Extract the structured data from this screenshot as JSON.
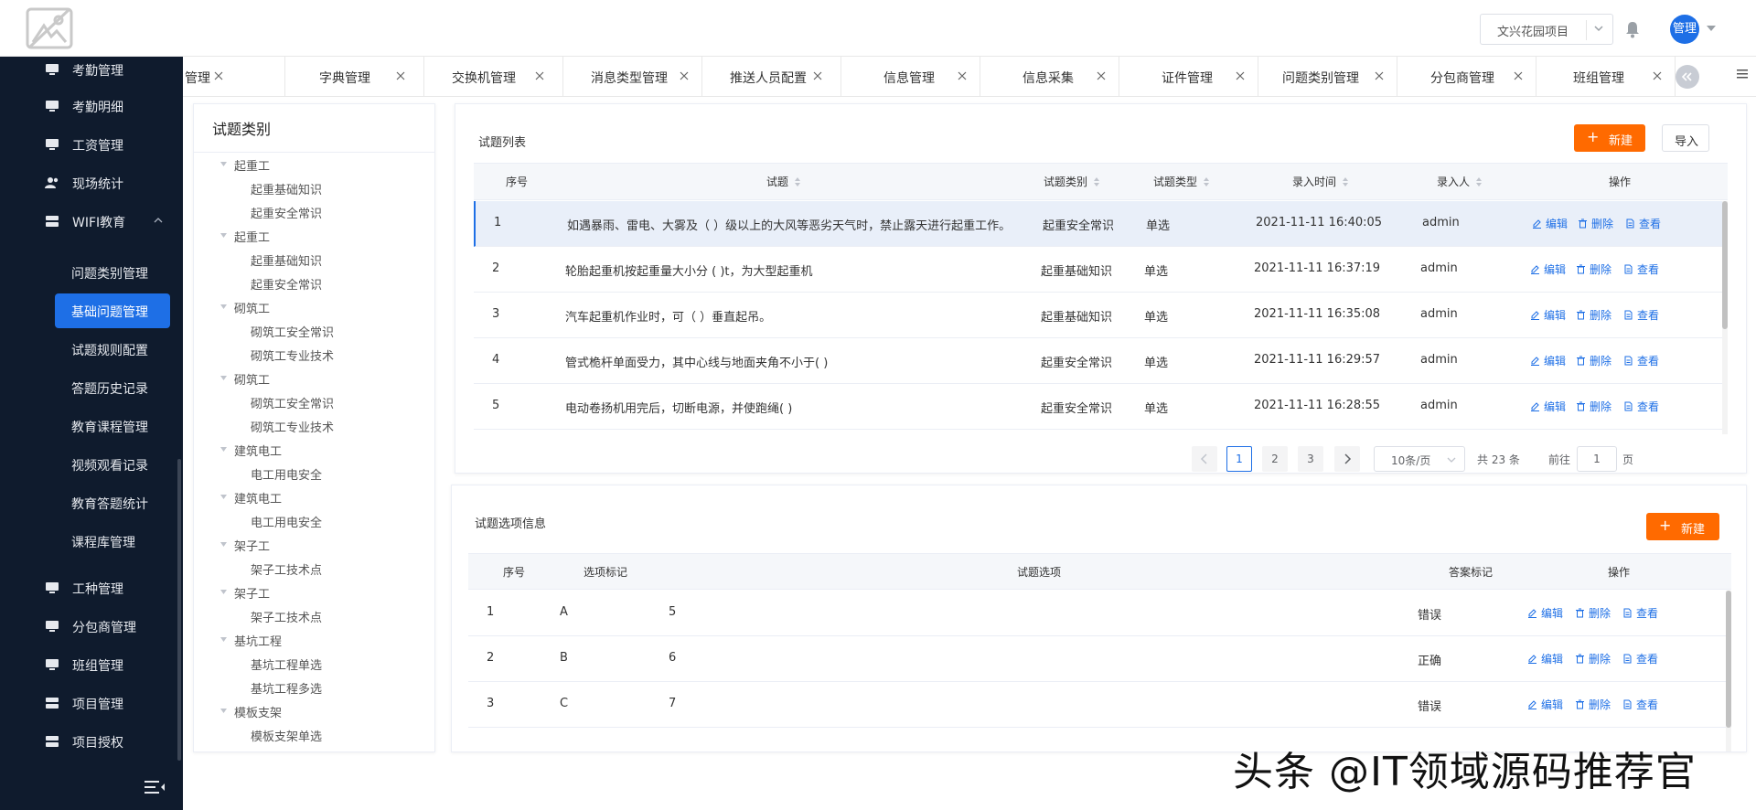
{
  "header": {
    "project": "文兴花园项目",
    "avatar_text": "管理"
  },
  "sidebar": {
    "items_top": [
      {
        "label": "考勤管理",
        "icon": "monitor-icon"
      },
      {
        "label": "考勤明细",
        "icon": "monitor-icon"
      },
      {
        "label": "工资管理",
        "icon": "monitor-icon"
      },
      {
        "label": "现场统计",
        "icon": "users-icon"
      },
      {
        "label": "WIFI教育",
        "icon": "server-icon"
      }
    ],
    "sub_items": [
      {
        "label": "问题类别管理"
      },
      {
        "label": "基础问题管理"
      },
      {
        "label": "试题规则配置"
      },
      {
        "label": "答题历史记录"
      },
      {
        "label": "教育课程管理"
      },
      {
        "label": "视频观看记录"
      },
      {
        "label": "教育答题统计"
      },
      {
        "label": "课程库管理"
      }
    ],
    "items_bottom": [
      {
        "label": "工种管理",
        "icon": "monitor-icon"
      },
      {
        "label": "分包商管理",
        "icon": "monitor-icon"
      },
      {
        "label": "班组管理",
        "icon": "monitor-icon"
      },
      {
        "label": "项目管理",
        "icon": "server-icon"
      },
      {
        "label": "项目授权",
        "icon": "server-icon"
      }
    ]
  },
  "tabs": [
    {
      "label": "管理"
    },
    {
      "label": "字典管理"
    },
    {
      "label": "交换机管理"
    },
    {
      "label": "消息类型管理"
    },
    {
      "label": "推送人员配置"
    },
    {
      "label": "信息管理"
    },
    {
      "label": "信息采集"
    },
    {
      "label": "证件管理"
    },
    {
      "label": "问题类别管理"
    },
    {
      "label": "分包商管理"
    },
    {
      "label": "班组管理"
    }
  ],
  "category_panel": {
    "title": "试题类别",
    "tree": [
      {
        "label": "起重工",
        "level": 0
      },
      {
        "label": "起重基础知识",
        "level": 1
      },
      {
        "label": "起重安全常识",
        "level": 1
      },
      {
        "label": "起重工",
        "level": 0
      },
      {
        "label": "起重基础知识",
        "level": 1
      },
      {
        "label": "起重安全常识",
        "level": 1
      },
      {
        "label": "砌筑工",
        "level": 0
      },
      {
        "label": "砌筑工安全常识",
        "level": 1
      },
      {
        "label": "砌筑工专业技术",
        "level": 1
      },
      {
        "label": "砌筑工",
        "level": 0
      },
      {
        "label": "砌筑工安全常识",
        "level": 1
      },
      {
        "label": "砌筑工专业技术",
        "level": 1
      },
      {
        "label": "建筑电工",
        "level": 0
      },
      {
        "label": "电工用电安全",
        "level": 1
      },
      {
        "label": "建筑电工",
        "level": 0
      },
      {
        "label": "电工用电安全",
        "level": 1
      },
      {
        "label": "架子工",
        "level": 0
      },
      {
        "label": "架子工技术点",
        "level": 1
      },
      {
        "label": "架子工",
        "level": 0
      },
      {
        "label": "架子工技术点",
        "level": 1
      },
      {
        "label": "基坑工程",
        "level": 0
      },
      {
        "label": "基坑工程单选",
        "level": 1
      },
      {
        "label": "基坑工程多选",
        "level": 1
      },
      {
        "label": "模板支架",
        "level": 0
      },
      {
        "label": "模板支架单选",
        "level": 1
      }
    ]
  },
  "question_panel": {
    "title": "试题列表",
    "new_label": "新建",
    "import_label": "导入",
    "columns": [
      "序号",
      "试题",
      "试题类别",
      "试题类型",
      "录入时间",
      "录入人",
      "操作"
    ],
    "actions": {
      "edit": "编辑",
      "delete": "删除",
      "view": "查看"
    },
    "rows": [
      {
        "no": "1",
        "question": "如遇暴雨、雷电、大雾及（ ）级以上的大风等恶劣天气时，禁止露天进行起重工作。",
        "category": "起重安全常识",
        "type": "单选",
        "time": "2021-11-11 16:40:05",
        "user": "admin"
      },
      {
        "no": "2",
        "question": "轮胎起重机按起重量大小分 ( )t，为大型起重机",
        "category": "起重基础知识",
        "type": "单选",
        "time": "2021-11-11 16:37:19",
        "user": "admin"
      },
      {
        "no": "3",
        "question": "汽车起重机作业时，可（ ）垂直起吊。",
        "category": "起重基础知识",
        "type": "单选",
        "time": "2021-11-11 16:35:08",
        "user": "admin"
      },
      {
        "no": "4",
        "question": "管式桅杆单面受力，其中心线与地面夹角不小于( )",
        "category": "起重安全常识",
        "type": "单选",
        "time": "2021-11-11 16:29:57",
        "user": "admin"
      },
      {
        "no": "5",
        "question": "电动卷扬机用完后，切断电源，并使跑绳( )",
        "category": "起重安全常识",
        "type": "单选",
        "time": "2021-11-11 16:28:55",
        "user": "admin"
      }
    ],
    "pagination": {
      "pages": [
        "1",
        "2",
        "3"
      ],
      "current": "1",
      "page_size": "10条/页",
      "total": "共 23 条",
      "goto_prefix": "前往",
      "goto_value": "1",
      "goto_suffix": "页"
    }
  },
  "option_panel": {
    "title": "试题选项信息",
    "new_label": "新建",
    "columns": [
      "序号",
      "选项标记",
      "试题选项",
      "答案标记",
      "操作"
    ],
    "rows": [
      {
        "no": "1",
        "mark": "A",
        "option": "5",
        "answer": "错误"
      },
      {
        "no": "2",
        "mark": "B",
        "option": "6",
        "answer": "正确"
      },
      {
        "no": "3",
        "mark": "C",
        "option": "7",
        "answer": "错误"
      }
    ]
  },
  "watermark": "头条 @IT领域源码推荐官",
  "colors": {
    "sidebar_bg": "#0f1b2d",
    "primary": "#1e6fe6",
    "accent": "#ff6a00"
  }
}
